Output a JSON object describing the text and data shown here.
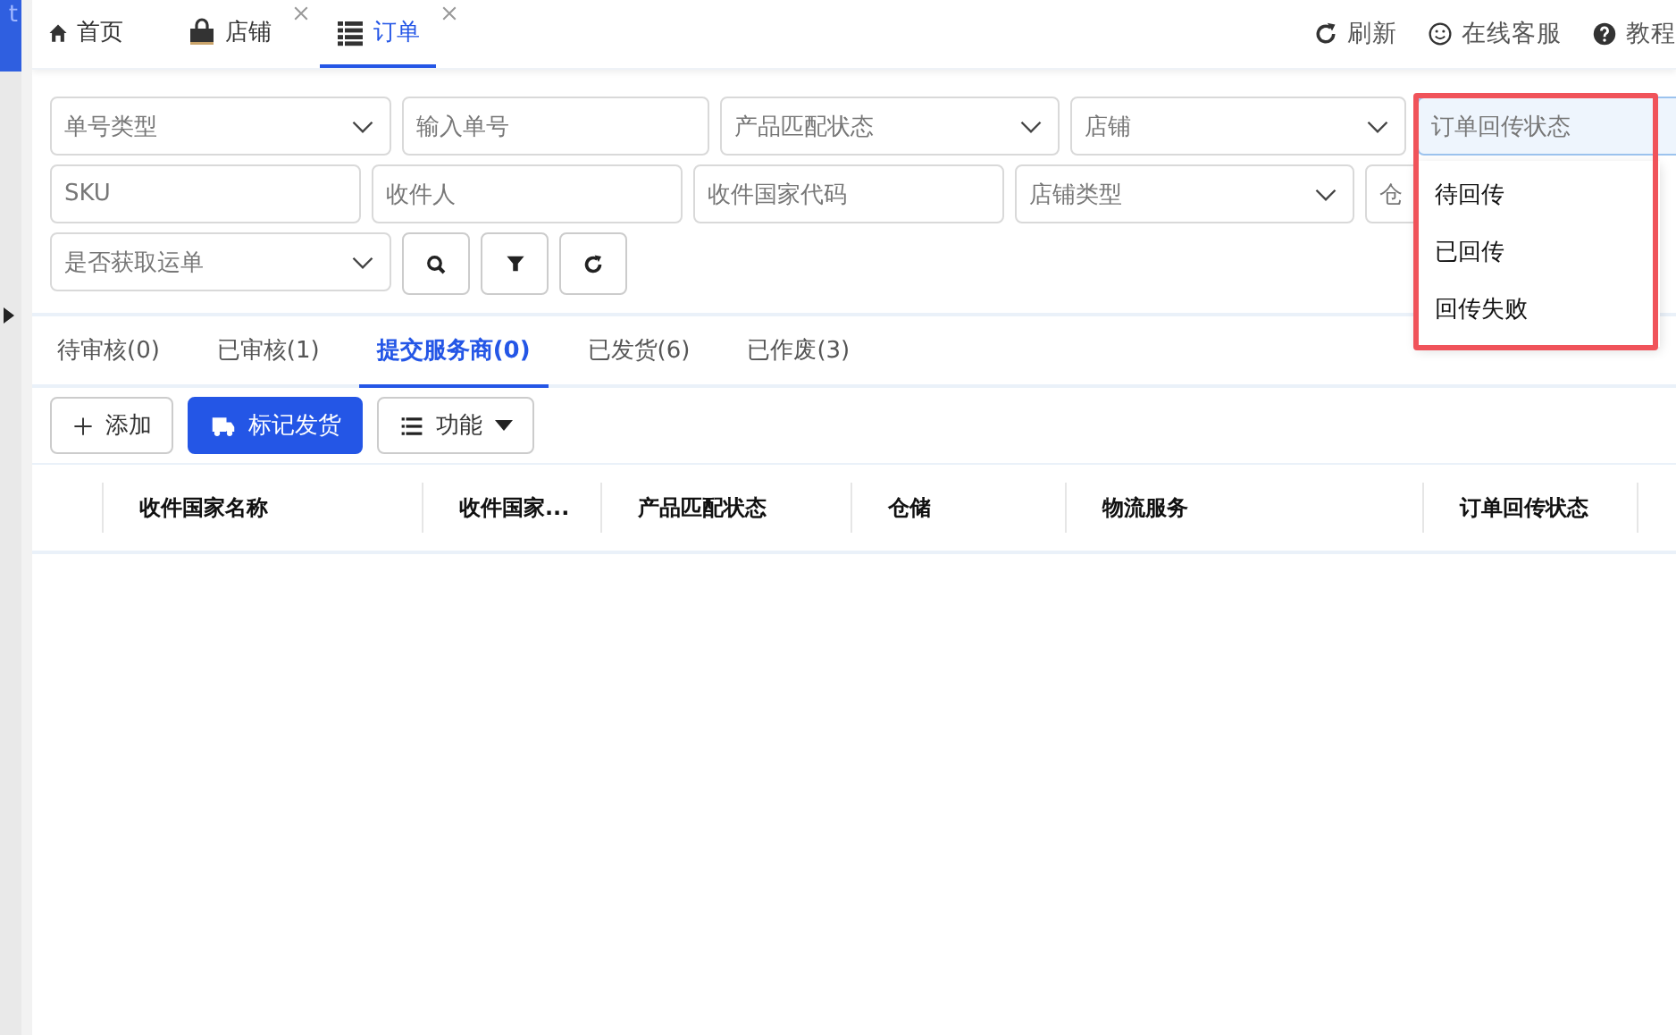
{
  "sidebar": {
    "text": "t"
  },
  "top_tabs": [
    {
      "label": "首页",
      "selected": false,
      "closable": false
    },
    {
      "label": "店铺",
      "selected": false,
      "closable": true
    },
    {
      "label": "订单",
      "selected": true,
      "closable": true
    }
  ],
  "top_actions": [
    {
      "label": "刷新"
    },
    {
      "label": "在线客服"
    },
    {
      "label": "教程"
    }
  ],
  "filters": [
    [
      {
        "kind": "select",
        "placeholder": "单号类型"
      },
      {
        "kind": "input",
        "placeholder": "输入单号"
      },
      {
        "kind": "select",
        "placeholder": "产品匹配状态"
      },
      {
        "kind": "select",
        "placeholder": "店铺"
      },
      {
        "kind": "select",
        "placeholder": "订单回传状态",
        "expanded": true,
        "options": [
          "待回传",
          "已回传",
          "回传失败"
        ]
      }
    ],
    [
      {
        "kind": "input",
        "placeholder": "SKU"
      },
      {
        "kind": "input",
        "placeholder": "收件人"
      },
      {
        "kind": "input",
        "placeholder": "收件国家代码"
      },
      {
        "kind": "select",
        "placeholder": "店铺类型"
      },
      {
        "kind": "input",
        "placeholder": "仓"
      }
    ],
    [
      {
        "kind": "select",
        "placeholder": "是否获取运单"
      }
    ]
  ],
  "filter_buttons": [
    {
      "kind": "search"
    },
    {
      "kind": "filter"
    },
    {
      "kind": "reset"
    }
  ],
  "status_tabs": [
    {
      "label": "待审核(0)",
      "selected": false
    },
    {
      "label": "已审核(1)",
      "selected": false
    },
    {
      "label": "提交服务商(0)",
      "selected": true
    },
    {
      "label": "已发货(6)",
      "selected": false
    },
    {
      "label": "已作废(3)",
      "selected": false
    }
  ],
  "toolbar": [
    {
      "kind": "add",
      "label": "添加"
    },
    {
      "kind": "primary",
      "label": "标记发货"
    },
    {
      "kind": "menu",
      "label": "功能"
    }
  ],
  "table": {
    "columns": [
      "收件国家名称",
      "收件国家...",
      "产品匹配状态",
      "仓储",
      "物流服务",
      "订单回传状态"
    ]
  }
}
